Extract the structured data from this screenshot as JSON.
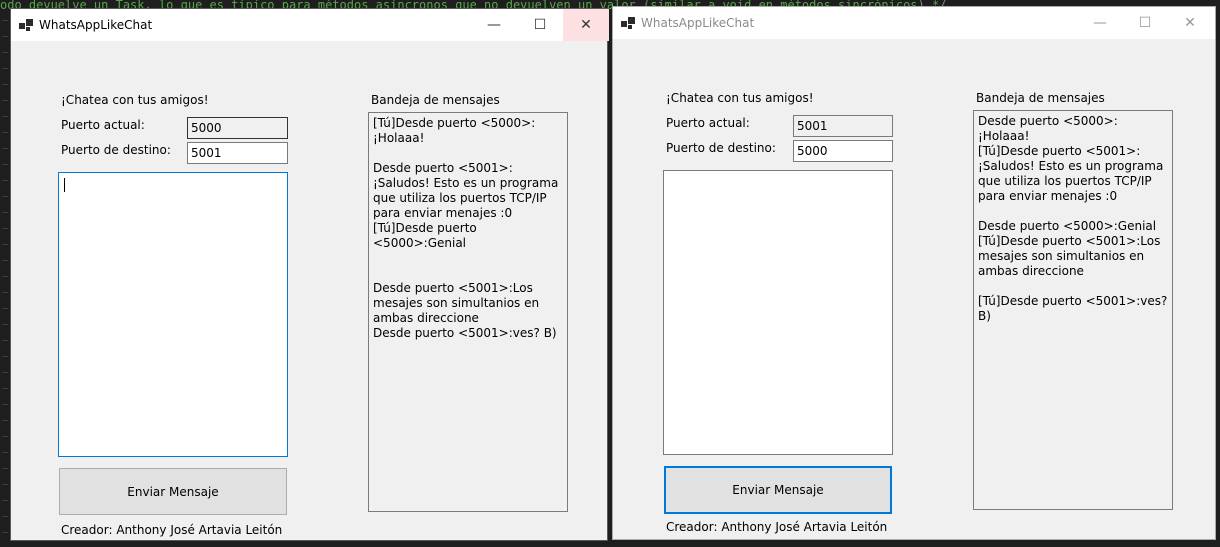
{
  "background_code": "odo devuelve un Task, lo que es típico para métodos asíncronos que no devuelven un valor (similar a void en métodos sincrónicos) */",
  "windows": [
    {
      "title": "WhatsAppLikeChat",
      "state": "active",
      "window_controls": [
        "minimize-icon",
        "maximize-icon",
        "close-icon"
      ],
      "greeting": "¡Chatea con tus amigos!",
      "current_port_label": "Puerto actual:",
      "current_port_value": "5000",
      "dest_port_label": "Puerto de destino:",
      "dest_port_value": "5001",
      "message_input_value": "",
      "send_button": "Enviar Mensaje",
      "inbox_label": "Bandeja de mensajes",
      "inbox_messages": [
        "[Tú]Desde puerto <5000>:¡Holaaa!",
        "",
        "Desde puerto <5001>:¡Saludos! Esto es un programa que utiliza los puertos TCP/IP para enviar menajes :0",
        "[Tú]Desde puerto <5000>:Genial",
        "",
        "",
        "Desde puerto <5001>:Los mesajes son simultanios en ambas direccione",
        "Desde puerto <5001>:ves? B)"
      ],
      "creator": "Creador: Anthony José Artavia Leitón"
    },
    {
      "title": "WhatsAppLikeChat",
      "state": "inactive",
      "window_controls": [
        "minimize-icon",
        "maximize-icon",
        "close-icon"
      ],
      "greeting": "¡Chatea con tus amigos!",
      "current_port_label": "Puerto actual:",
      "current_port_value": "5001",
      "dest_port_label": "Puerto de destino:",
      "dest_port_value": "5000",
      "message_input_value": "",
      "send_button": "Enviar Mensaje",
      "inbox_label": "Bandeja de mensajes",
      "inbox_messages": [
        "Desde puerto <5000>:¡Holaaa!",
        "[Tú]Desde puerto <5001>:¡Saludos! Esto es un programa que utiliza los puertos TCP/IP para enviar menajes :0",
        "",
        "Desde puerto <5000>:Genial",
        "[Tú]Desde puerto <5001>:Los mesajes son simultanios en ambas direccione",
        "",
        "[Tú]Desde puerto <5001>:ves? B)"
      ],
      "creator": "Creador: Anthony José Artavia Leitón"
    }
  ],
  "colors": {
    "form_background": "#f0f0f0",
    "focus_accent": "#0078d7",
    "close_hover": "#fde1e2",
    "editor_background": "#1e1e1e"
  }
}
